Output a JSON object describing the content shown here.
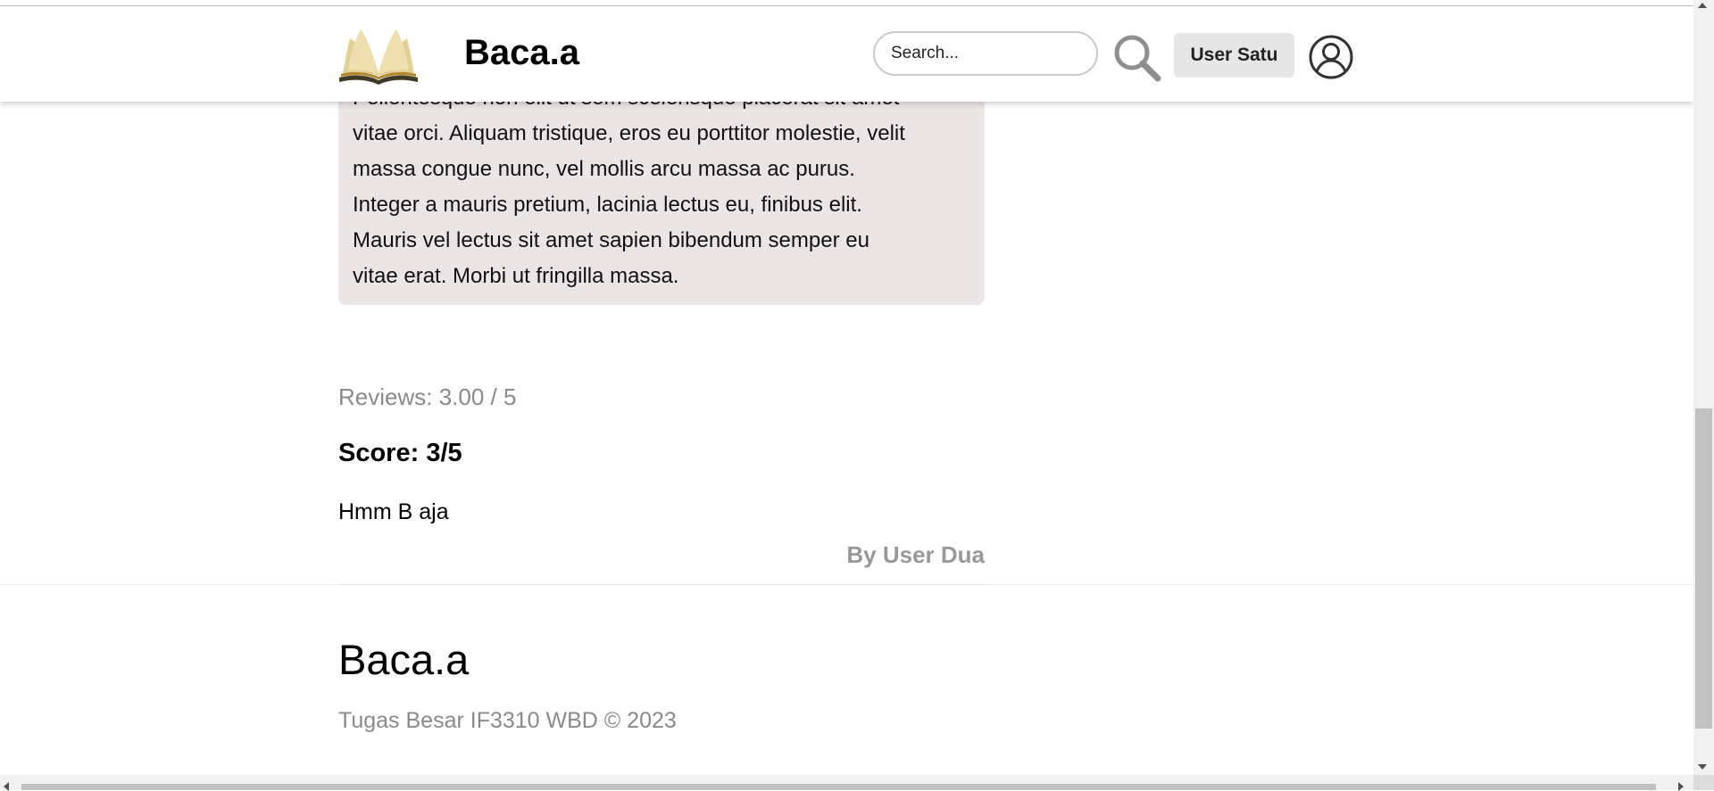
{
  "header": {
    "brand": "Baca.a",
    "search_placeholder": "Search...",
    "user_button_label": "User Satu",
    "icons": {
      "logo": "open-book-logo",
      "search": "magnifier-icon",
      "account": "user-circle-icon"
    }
  },
  "book": {
    "description_partial_top": "Pellentesque non elit ut sem scelerisque placerat sit amet",
    "description_lines": [
      "vitae orci. Aliquam tristique, eros eu porttitor molestie, velit",
      "massa congue nunc, vel mollis arcu massa ac purus.",
      "Integer a mauris pretium, lacinia lectus eu, finibus elit.",
      "Mauris vel lectus sit amet sapien bibendum semper eu",
      "vitae erat. Morbi ut fringilla massa."
    ]
  },
  "reviews": {
    "summary": "Reviews: 3.00 / 5",
    "items": [
      {
        "score": "Score: 3/5",
        "comment": "Hmm B aja",
        "author": "By User Dua"
      }
    ]
  },
  "footer": {
    "brand": "Baca.a",
    "copyright": "Tugas Besar IF3310 WBD © 2023"
  },
  "scrollbar": {
    "vertical_position": 0.88
  }
}
